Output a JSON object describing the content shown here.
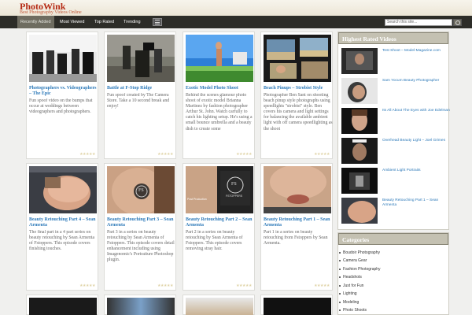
{
  "site": {
    "title": "PhotoWink",
    "tagline": "Best Photography Videos Online"
  },
  "nav": {
    "items": [
      "Recently Added",
      "Most Viewed",
      "Top Rated",
      "Trending"
    ],
    "active_index": 0
  },
  "search": {
    "placeholder": "Search this site..."
  },
  "posts": [
    {
      "title": "Photographers vs. Videographers – The Epic",
      "excerpt": "Fun spoof video on the bumps that occur at weddings between videographers and photographers."
    },
    {
      "title": "Battle at F-Stop Ridge",
      "excerpt": "Fun spoof created by The Camera Store. Take a 10 second break and enjoy!"
    },
    {
      "title": "Exotic Model Photo Shoot",
      "excerpt": "Behind the scenes glamour photo shoot of exotic model Brianna Martinez by fashion photographer Arthur St. John. Watch carfully to catch his lighting setup. He's using a small bounce umbrella and a beauty dish to create some"
    },
    {
      "title": "Beach Pinups – Strobist Style",
      "excerpt": "Photographer Ben Sant on shooting beach pinup style photographs using speedlights \"strobist\" style. Ben covers his camera and light settings for balancing the available ambient light with off camera speedlighting as the shoot"
    },
    {
      "title": "Beauty Retouching Part 4 – Sean Armenta",
      "excerpt": "The final part in a 4 part series on beauty retouching by Sean Armenta of Fstoppers. This episode covers finishing touches."
    },
    {
      "title": "Beauty Retouching Part 3 – Sean Armenta",
      "excerpt": "Part 3 in a series on beauty retouching by Sean Armenta of Fstoppers. This episode covers detail enhancement including using Imagenomic's Portraiture Photoshop plugin."
    },
    {
      "title": "Beauty Retouching Part 2 – Sean Armenta",
      "excerpt": "Part 2 in a series on beauty retouching by Sean Armenta of Fstoppers. This episode covers removing stray hair."
    },
    {
      "title": "Beauty Retouching Part 1 – Sean Armenta",
      "excerpt": "Part 1 in a series on beauty retouching from Fstoppers by Sean Armenta."
    }
  ],
  "ratings": {
    "stars_text": "★★★★★"
  },
  "thumb_labels": {
    "fs": "FS",
    "fs_sub": "FSTOPPERS",
    "post_prod": "Post Production"
  },
  "sidebar": {
    "highest_rated": {
      "heading": "Highest Rated Videos",
      "items": [
        "Test Shoot – Model-Magazine.com",
        "Sam Yocum Beauty Photographer",
        "Its All About The Eyes with Joe Edelman",
        "Overhead Beauty Light – Joel Grimes",
        "Ambient Light Portraits",
        "Beauty Retouching Part 1 – Sean Armenta"
      ]
    },
    "categories": {
      "heading": "Categories",
      "items": [
        "Boudoir Photography",
        "Camera Gear",
        "Fashion Photography",
        "Headshots",
        "Just for Fun",
        "Lighting",
        "Modeling",
        "Photo Shoots"
      ]
    }
  },
  "colors": {
    "accent_link": "#2b78b8",
    "brand": "#b52a14",
    "nav_bg": "#2d2d28",
    "star": "#e0d4a8"
  }
}
